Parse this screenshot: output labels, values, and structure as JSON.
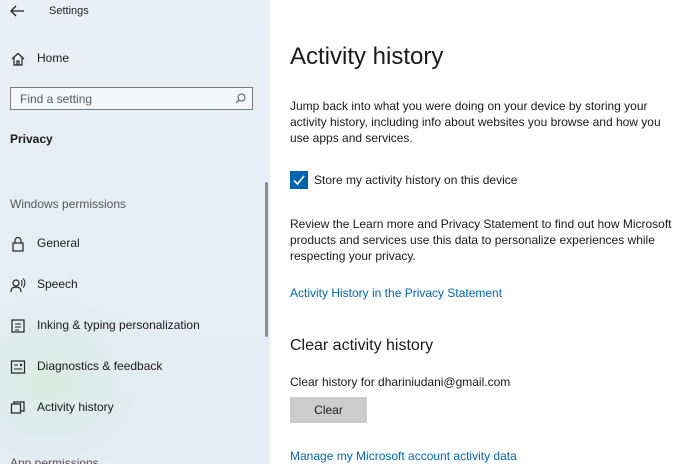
{
  "window": {
    "title": "Settings",
    "back_icon": "back-arrow-icon"
  },
  "sidebar": {
    "home": {
      "label": "Home",
      "icon": "home-icon"
    },
    "search": {
      "placeholder": "Find a setting",
      "icon": "search-icon"
    },
    "current_section": "Privacy",
    "group_headers": [
      "Windows permissions",
      "App permissions"
    ],
    "items": [
      {
        "label": "General",
        "icon": "lock-icon"
      },
      {
        "label": "Speech",
        "icon": "speech-icon"
      },
      {
        "label": "Inking & typing personalization",
        "icon": "inking-icon"
      },
      {
        "label": "Diagnostics & feedback",
        "icon": "diagnostics-icon"
      },
      {
        "label": "Activity history",
        "icon": "activity-history-icon"
      }
    ]
  },
  "main": {
    "title": "Activity history",
    "intro": "Jump back into what you were doing on your device by storing your activity history, including info about websites you browse and how you use apps and services.",
    "store_checkbox": {
      "label": "Store my activity history on this device",
      "checked": true
    },
    "review_text": "Review the Learn more and Privacy Statement to find out how Microsoft products and services use this data to personalize experiences while respecting your privacy.",
    "privacy_link": "Activity History in the Privacy Statement",
    "clear_section": {
      "title": "Clear activity history",
      "clear_for": "Clear history for dhariniudani@gmail.com",
      "button": "Clear"
    },
    "manage_link": "Manage my Microsoft account activity data"
  },
  "colors": {
    "accent": "#0063b1",
    "link": "#0067b8",
    "sidebar_bg": "#e7eef5",
    "button_bg": "#cccccc"
  }
}
